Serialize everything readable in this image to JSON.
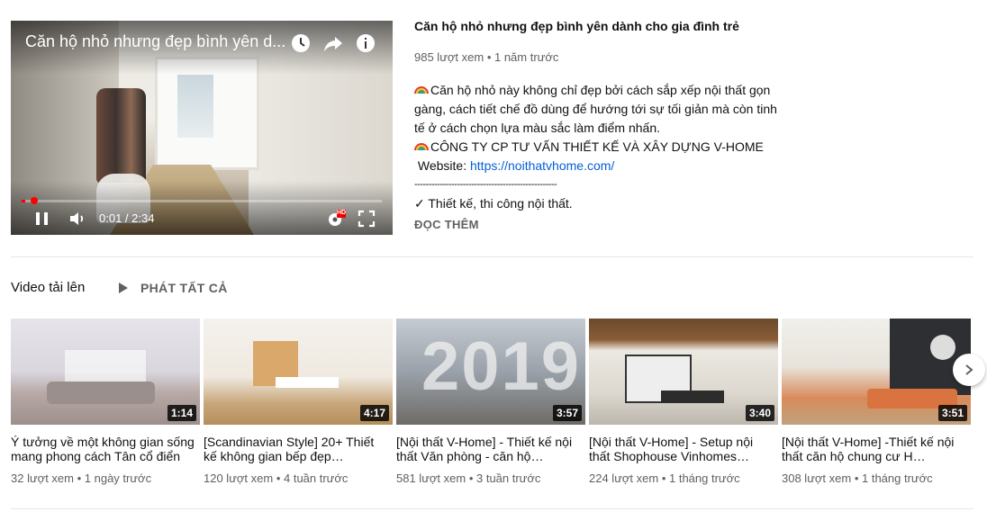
{
  "player": {
    "title": "Căn hộ nhỏ nhưng đẹp bình yên d...",
    "current_time": "0:01",
    "separator": " / ",
    "duration": "2:34",
    "progress": 0.01,
    "quality_badge": "HD"
  },
  "video_info": {
    "title": "Căn hộ nhỏ nhưng đẹp bình yên dành cho gia đình trẻ",
    "views": "985 lượt xem",
    "dot": " • ",
    "age": "1 năm trước",
    "desc_line1": "Căn hộ nhỏ này không chỉ đẹp bởi cách sắp xếp nội thất gọn gàng, cách tiết chế đồ dùng để hướng tới sự tối giản mà còn tinh tế ở cách chọn lựa màu sắc làm điểm nhấn.",
    "desc_line2": "CÔNG TY CP TƯ VẤN THIẾT KẾ VÀ XÂY DỰNG V-HOME",
    "website_label": " Website: ",
    "website_url": "https://noithatvhome.com/",
    "rule": "--------------------------------------------------",
    "desc_line3": "✓ Thiết kế, thi công nội thất.",
    "read_more": "ĐỌC THÊM"
  },
  "uploads": {
    "title": "Video tải lên",
    "play_all": "PHÁT TẤT CẢ",
    "videos": [
      {
        "title": "Ý tưởng về một không gian sống mang phong cách Tân cổ điển",
        "duration": "1:14",
        "views": "32 lượt xem",
        "age": "1 ngày trước"
      },
      {
        "title": "[Scandinavian Style] 20+ Thiết kế không gian bếp đẹp…",
        "duration": "4:17",
        "views": "120 lượt xem",
        "age": "4 tuần trước"
      },
      {
        "title": "[Nội thất V-Home] - Thiết kế nội thất Văn phòng - căn hộ…",
        "duration": "3:57",
        "views": "581 lượt xem",
        "age": "3 tuần trước",
        "overlay": "2019"
      },
      {
        "title": "[Nội thất V-Home] - Setup nội thất Shophouse Vinhomes…",
        "duration": "3:40",
        "views": "224 lượt xem",
        "age": "1 tháng trước"
      },
      {
        "title": "[Nội thất V-Home] -Thiết kế nội thất căn hộ chung cư H…",
        "duration": "3:51",
        "views": "308 lượt xem",
        "age": "1 tháng trước"
      }
    ]
  },
  "icons": {
    "watch_later": "clock-icon",
    "share": "share-icon",
    "info": "info-icon",
    "pause": "pause-icon",
    "volume": "volume-icon",
    "settings": "gear-icon",
    "fullscreen": "fullscreen-icon",
    "play_all": "play-icon",
    "next": "chevron-right-icon",
    "emoji": "rainbow-icon"
  },
  "colors": {
    "progress": "#ff0000",
    "link": "#065fd4",
    "muted": "#606060"
  }
}
